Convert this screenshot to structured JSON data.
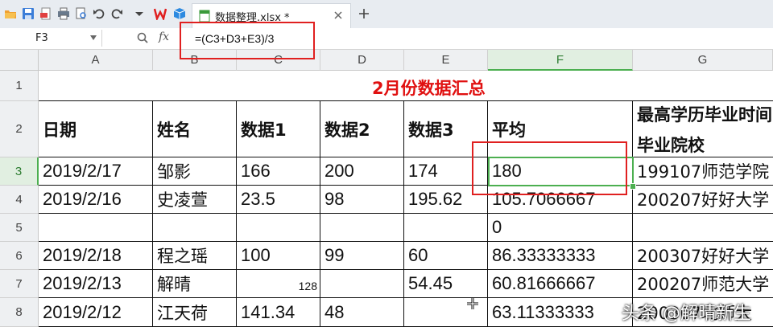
{
  "app": {
    "tab_title": "数据整理.xlsx *"
  },
  "formula_bar": {
    "name_box": "F3",
    "fx_label": "fx",
    "formula": "=(C3+D3+E3)/3"
  },
  "columns": [
    "A",
    "B",
    "C",
    "D",
    "E",
    "F",
    "G"
  ],
  "rows": [
    "1",
    "2",
    "3",
    "4",
    "5",
    "6",
    "7",
    "8"
  ],
  "sheet": {
    "title": "2月份数据汇总",
    "headers": {
      "A": "日期",
      "B": "姓名",
      "C": "数据1",
      "D": "数据2",
      "E": "数据3",
      "F": "平均",
      "G_line1": "最高学历毕业时间",
      "G_line2": "毕业院校"
    },
    "data": [
      {
        "A": "2019/2/17",
        "B": "邹影",
        "C": "166",
        "D": "200",
        "E": "174",
        "F": "180",
        "G": "199107师范学院"
      },
      {
        "A": "2019/2/16",
        "B": "史凌萱",
        "C": "23.5",
        "D": "98",
        "E": "195.62",
        "F": "105.7066667",
        "G": "200207好好大学"
      },
      {
        "A": "",
        "B": "",
        "C": "",
        "D": "",
        "E": "",
        "F": "0",
        "G": ""
      },
      {
        "A": "2019/2/18",
        "B": "程之瑶",
        "C": "100",
        "D": "99",
        "E": "60",
        "F": "86.33333333",
        "G": "200307好好大学"
      },
      {
        "A": "2019/2/13",
        "B": "解晴",
        "C": "128",
        "D": "",
        "E": "54.45",
        "F": "60.81666667",
        "G": "200207师范大学"
      },
      {
        "A": "2019/2/12",
        "B": "江天荷",
        "C": "141.34",
        "D": "48",
        "E": "",
        "F": "63.11333333",
        "G": "200307北师大"
      }
    ]
  },
  "watermark": "头条 @解晴新生",
  "colors": {
    "accent_green": "#4caf50",
    "title_red": "#e01010",
    "annotation_red": "#e02020"
  }
}
